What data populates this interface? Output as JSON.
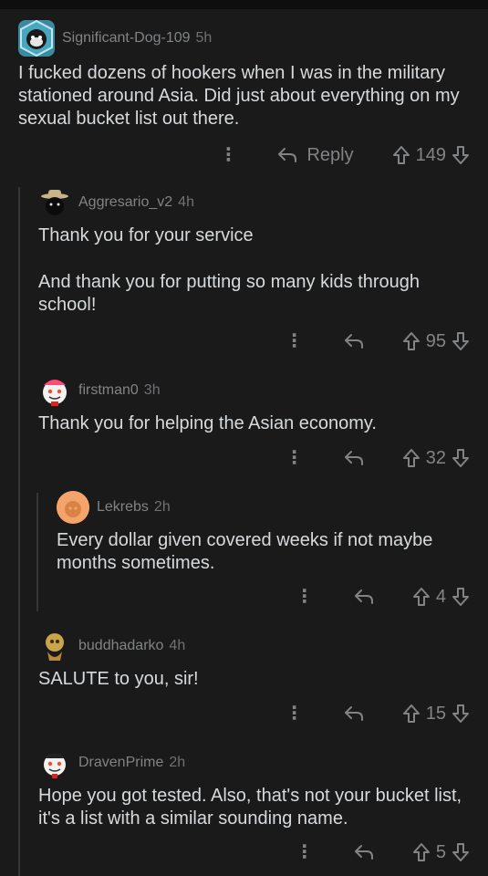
{
  "comments": [
    {
      "username": "Significant-Dog-109",
      "age": "5h",
      "body": [
        "I fucked dozens of hookers when I was in the military stationed around Asia. Did just about everything on my sexual bucket list out there."
      ],
      "reply_label": "Reply",
      "score": "149",
      "avatar_icon": "dog-avatar-icon"
    },
    {
      "username": "Aggresario_v2",
      "age": "4h",
      "body": [
        "Thank you for your service",
        "And thank you for putting so many kids through school!"
      ],
      "score": "95",
      "avatar_icon": "cowboy-avatar-icon"
    },
    {
      "username": "firstman0",
      "age": "3h",
      "body": [
        "Thank you for helping the Asian economy."
      ],
      "score": "32",
      "avatar_icon": "snoo-avatar-icon"
    },
    {
      "username": "Lekrebs",
      "age": "2h",
      "body": [
        "Every dollar given covered weeks if not maybe months sometimes."
      ],
      "score": "4",
      "avatar_icon": "default-avatar-icon"
    },
    {
      "username": "buddhadarko",
      "age": "4h",
      "body": [
        "SALUTE to you, sir!"
      ],
      "score": "15",
      "avatar_icon": "painting-avatar-icon"
    },
    {
      "username": "DravenPrime",
      "age": "2h",
      "body": [
        "Hope you got tested. Also, that's not your bucket list, it's a list with a similar sounding name."
      ],
      "score": "5",
      "avatar_icon": "snoo-avatar-icon"
    }
  ],
  "colors": {
    "background": "#1a1a1b",
    "text": "#d7dadc",
    "meta": "#818384",
    "rail": "#343536"
  }
}
